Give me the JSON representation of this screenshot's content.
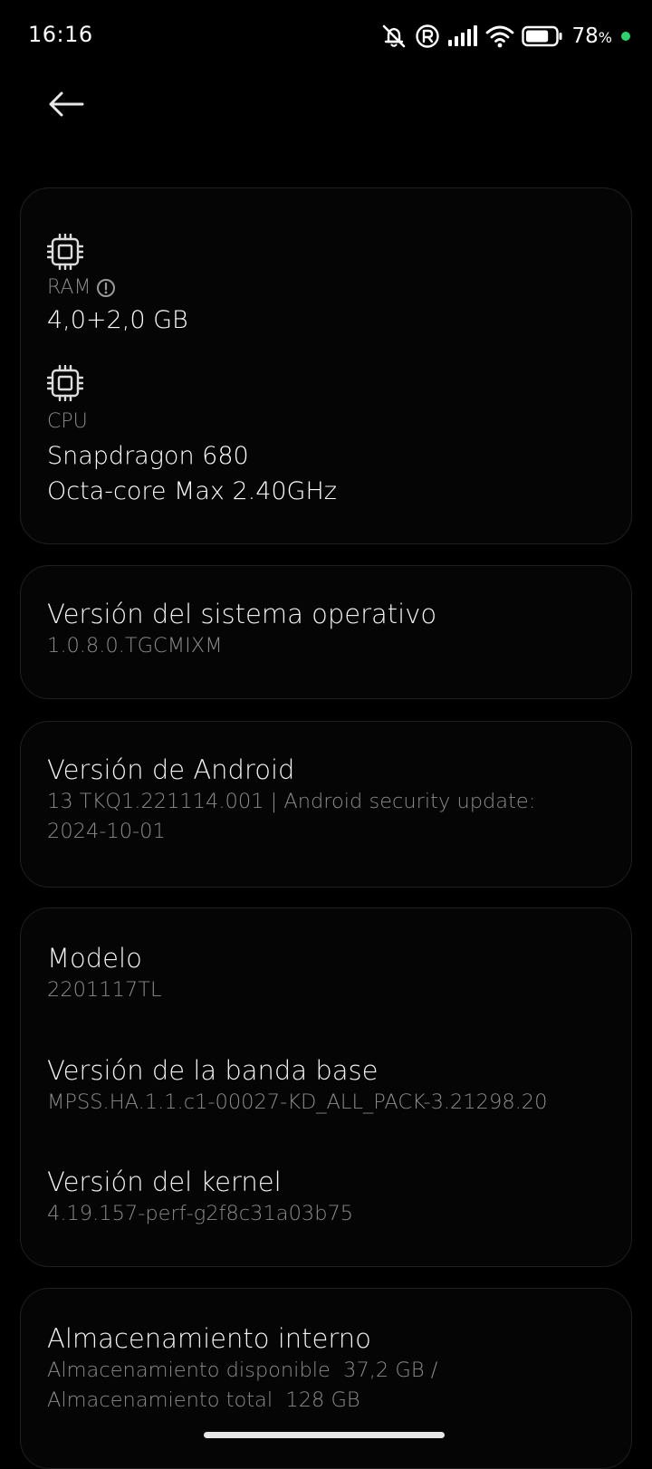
{
  "status_bar": {
    "time": "16:16",
    "battery_percent": "78",
    "battery_percent_sign": "%",
    "battery_level": 0.78,
    "charging_color": "#2ed36b",
    "icons": [
      "mute-icon",
      "registered-icon",
      "signal-icon",
      "wifi-icon",
      "battery-icon"
    ]
  },
  "nav": {
    "back_icon": "arrow-left-icon"
  },
  "specs": {
    "ram": {
      "icon": "chip-icon",
      "label": "RAM",
      "info_icon": "info-circle-icon",
      "value": "4,0+2,0 GB"
    },
    "cpu": {
      "icon": "chip-icon",
      "label": "CPU",
      "value_line1": "Snapdragon 680",
      "value_line2": "Octa-core Max 2.40GHz"
    }
  },
  "os_version": {
    "title": "Versión del sistema operativo",
    "value": "1.0.8.0.TGCMIXM"
  },
  "android_version": {
    "title": "Versión de Android",
    "value_line1": "13 TKQ1.221114.001 | Android security update:",
    "value_line2": "2024-10-01"
  },
  "device_info": {
    "model": {
      "title": "Modelo",
      "value": "2201117TL"
    },
    "baseband": {
      "title": "Versión de la banda base",
      "value": "MPSS.HA.1.1.c1-00027-KD_ALL_PACK-3.21298.20"
    },
    "kernel": {
      "title": "Versión del kernel",
      "value": "4.19.157-perf-g2f8c31a03b75"
    }
  },
  "storage": {
    "title": "Almacenamiento interno",
    "available_label": "Almacenamiento disponible",
    "available_value": "37,2 GB /",
    "total_label": "Almacenamiento total",
    "total_value": "128 GB"
  }
}
